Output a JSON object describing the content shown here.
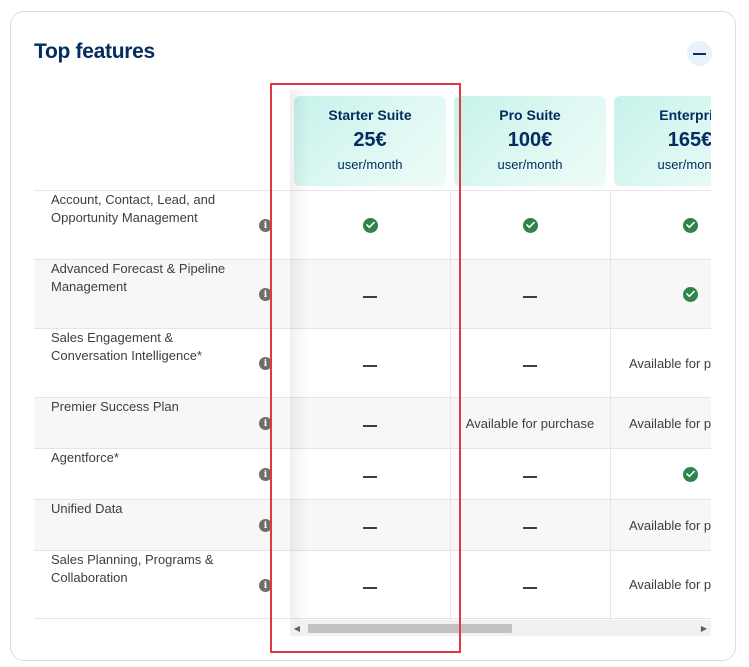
{
  "section": {
    "title": "Top features",
    "collapse_icon": "minus-icon"
  },
  "plans": [
    {
      "name": "Starter Suite",
      "price": "25€",
      "unit": "user/month"
    },
    {
      "name": "Pro Suite",
      "price": "100€",
      "unit": "user/month"
    },
    {
      "name": "Enterpris",
      "price": "165€",
      "unit": "user/month"
    }
  ],
  "rows": [
    {
      "feature": "Account, Contact, Lead, and Opportunity Management",
      "values": [
        "check",
        "check",
        "check"
      ]
    },
    {
      "feature": "Advanced Forecast & Pipeline Management",
      "values": [
        "dash",
        "dash",
        "check"
      ]
    },
    {
      "feature": "Sales Engagement & Conversation Intelligence*",
      "values": [
        "dash",
        "dash",
        "Available for pu"
      ]
    },
    {
      "feature": "Premier Success Plan",
      "values": [
        "dash",
        "Available for purchase",
        "Available for pu"
      ]
    },
    {
      "feature": "Agentforce*",
      "values": [
        "dash",
        "dash",
        "check"
      ]
    },
    {
      "feature": "Unified Data",
      "values": [
        "dash",
        "dash",
        "Available for pu"
      ]
    },
    {
      "feature": "Sales Planning, Programs & Collaboration",
      "values": [
        "dash",
        "dash",
        "Available for pu"
      ]
    }
  ],
  "colors": {
    "title": "#032d60",
    "check": "#2e844a",
    "highlight_box": "#e0393e"
  }
}
